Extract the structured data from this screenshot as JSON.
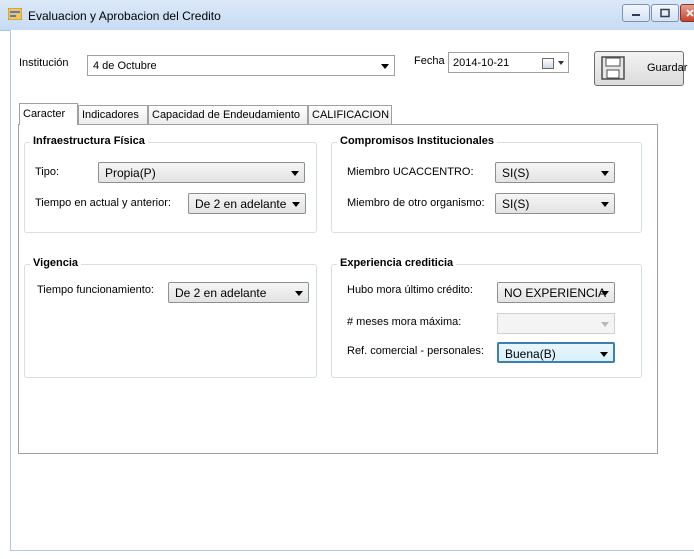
{
  "window": {
    "title": "Evaluacion y Aprobacion del Credito"
  },
  "header": {
    "institucion_label": "Institución",
    "institucion_value": "4 de Octubre",
    "fecha_label": "Fecha",
    "fecha_value": "2014-10-21",
    "save_label": "Guardar"
  },
  "tabs": [
    {
      "label": "Caracter",
      "active": true
    },
    {
      "label": "Indicadores",
      "active": false
    },
    {
      "label": "Capacidad de Endeudamiento",
      "active": false
    },
    {
      "label": "CALIFICACION",
      "active": false
    }
  ],
  "infraestructura": {
    "title": "Infraestructura Física",
    "tipo_label": "Tipo:",
    "tipo_value": "Propia(P)",
    "tiempo_label": "Tiempo en actual y anterior:",
    "tiempo_value": "De 2 en adelante"
  },
  "compromisos": {
    "title": "Compromisos Institucionales",
    "miembro_ucaccentro_label": "Miembro UCACCENTRO:",
    "miembro_ucaccentro_value": "SI(S)",
    "miembro_otro_label": "Miembro de otro organismo:",
    "miembro_otro_value": "SI(S)"
  },
  "vigencia": {
    "title": "Vigencia",
    "tiempo_label": "Tiempo funcionamiento:",
    "tiempo_value": "De 2 en adelante"
  },
  "experiencia": {
    "title": "Experiencia crediticia",
    "mora_label": "Hubo mora último crédito:",
    "mora_value": "NO EXPERIENCIA",
    "meses_label": "# meses mora máxima:",
    "meses_value": "",
    "ref_label": "Ref. comercial - personales:",
    "ref_value": "Buena(B)"
  }
}
